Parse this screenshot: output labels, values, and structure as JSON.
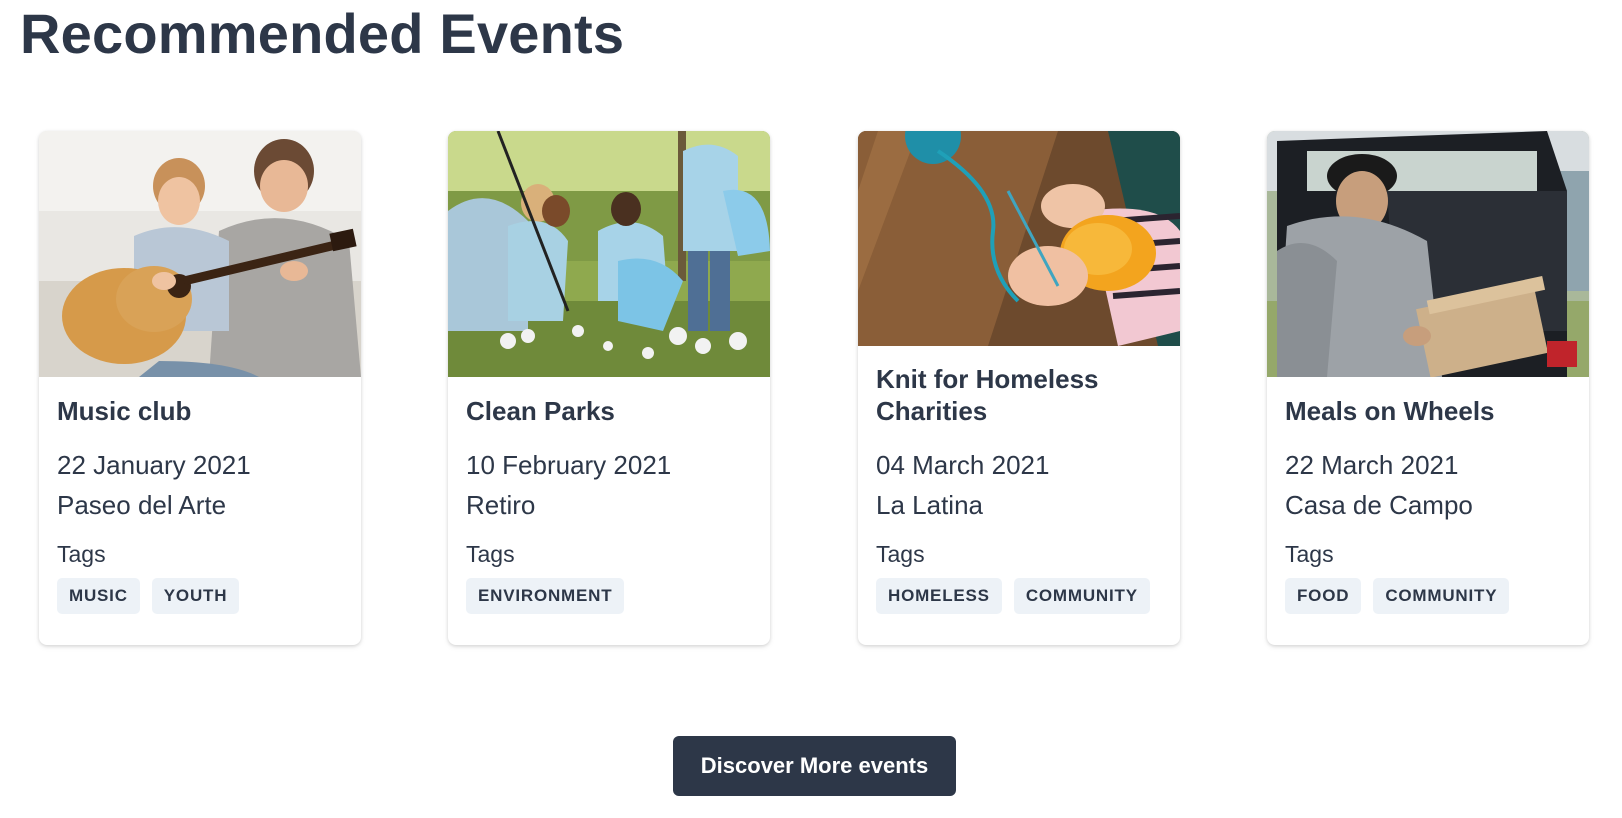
{
  "page": {
    "title": "Recommended Events"
  },
  "events": [
    {
      "title": "Music club",
      "date": "22 January 2021",
      "location": "Paseo del Arte",
      "tags_label": "Tags",
      "tags": [
        "MUSIC",
        "YOUTH"
      ],
      "image": "photo-boy-and-man-playing-guitar"
    },
    {
      "title": "Clean Parks",
      "date": "10 February 2021",
      "location": "Retiro",
      "tags_label": "Tags",
      "tags": [
        "ENVIRONMENT"
      ],
      "image": "photo-volunteers-cleaning-park"
    },
    {
      "title": "Knit for Homeless Charities",
      "date": "04 March 2021",
      "location": "La Latina",
      "tags_label": "Tags",
      "tags": [
        "HOMELESS",
        "COMMUNITY"
      ],
      "image": "photo-hands-knitting-yellow-wool"
    },
    {
      "title": "Meals on Wheels",
      "date": "22 March 2021",
      "location": "Casa de Campo",
      "tags_label": "Tags",
      "tags": [
        "FOOD",
        "COMMUNITY"
      ],
      "image": "photo-man-loading-box-into-car-trunk"
    }
  ],
  "cta": {
    "label": "Discover More events"
  },
  "colors": {
    "text": "#2d3748",
    "tag_bg": "#edf2f7",
    "button_bg": "#2d3748",
    "button_text": "#ffffff"
  }
}
